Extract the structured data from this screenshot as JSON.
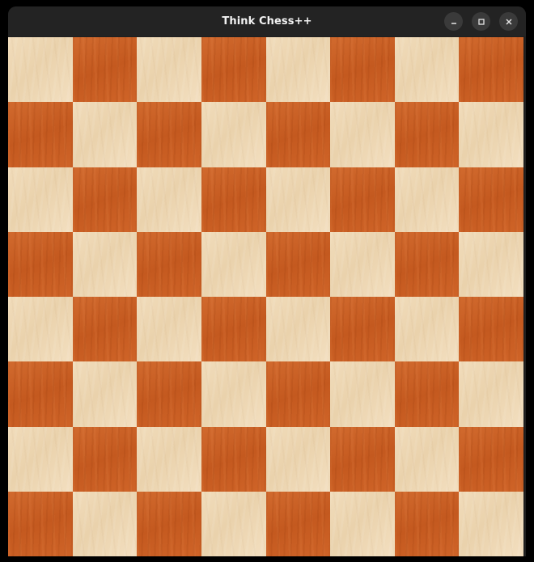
{
  "window": {
    "title": "Think Chess++"
  },
  "controls": {
    "minimize_icon": "minimize-icon",
    "maximize_icon": "maximize-icon",
    "close_icon": "close-icon"
  },
  "board": {
    "files": 8,
    "ranks": 8,
    "light_color": "#f0d9b5",
    "dark_color": "#c95f22",
    "top_left": "light"
  }
}
